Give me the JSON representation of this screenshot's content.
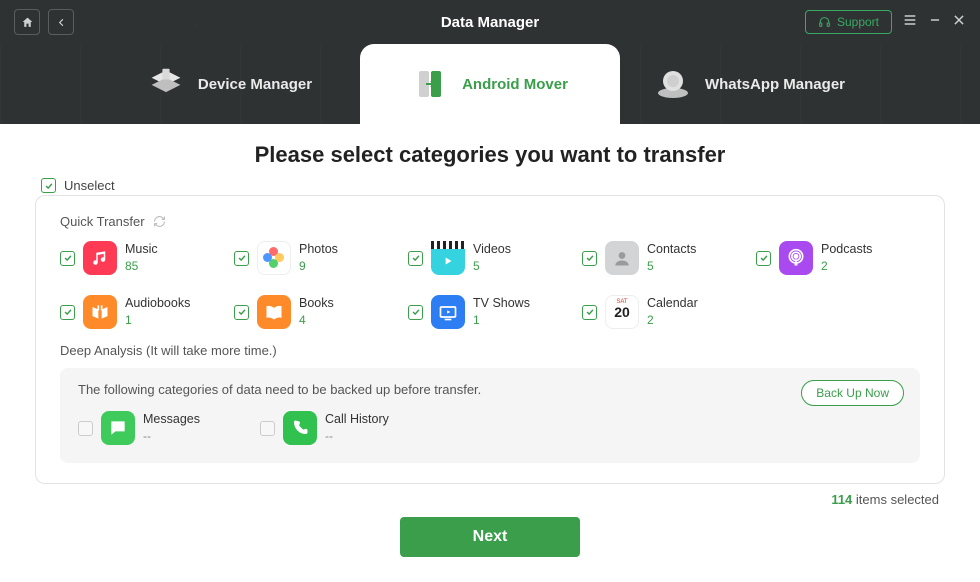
{
  "app": {
    "title": "Data Manager"
  },
  "titlebar": {
    "support": "Support"
  },
  "nav": {
    "deviceManager": "Device Manager",
    "androidMover": "Android Mover",
    "whatsappManager": "WhatsApp Manager"
  },
  "main": {
    "heading": "Please select categories you want to transfer",
    "unselect": "Unselect",
    "quickTransfer": "Quick Transfer",
    "deepAnalysis": "Deep Analysis (It will take more time.)",
    "deepNote": "The following categories of data need to be backed up before transfer.",
    "backupNow": "Back Up Now",
    "statusCount": "114",
    "statusSuffix": " items selected",
    "next": "Next"
  },
  "categories": [
    {
      "label": "Music",
      "count": "85"
    },
    {
      "label": "Photos",
      "count": "9"
    },
    {
      "label": "Videos",
      "count": "5"
    },
    {
      "label": "Contacts",
      "count": "5"
    },
    {
      "label": "Podcasts",
      "count": "2"
    },
    {
      "label": "Audiobooks",
      "count": "1"
    },
    {
      "label": "Books",
      "count": "4"
    },
    {
      "label": "TV Shows",
      "count": "1"
    },
    {
      "label": "Calendar",
      "count": "2"
    }
  ],
  "deepItems": [
    {
      "label": "Messages",
      "count": "--"
    },
    {
      "label": "Call History",
      "count": "--"
    }
  ],
  "calendar": {
    "weekday": "SAT",
    "day": "20"
  }
}
